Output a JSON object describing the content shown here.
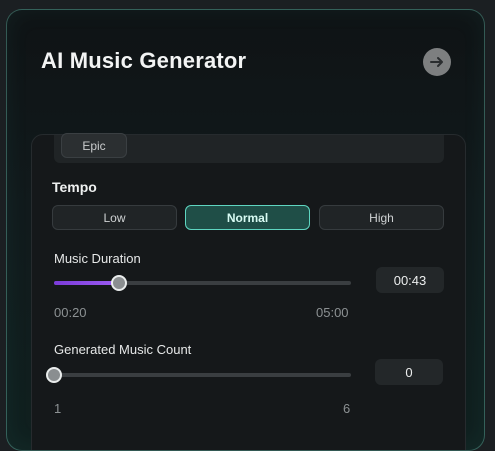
{
  "header": {
    "title": "AI Music Generator",
    "nav_icon": "arrow-right-icon"
  },
  "styles": {
    "selected_chip": "Epic"
  },
  "tempo": {
    "label": "Tempo",
    "options": [
      "Low",
      "Normal",
      "High"
    ],
    "selected": "Normal"
  },
  "duration": {
    "label": "Music Duration",
    "min_label": "00:20",
    "max_label": "05:00",
    "value": "00:43",
    "fraction": 0.22
  },
  "count": {
    "label": "Generated Music Count",
    "min_label": "1",
    "max_label": "6",
    "value": "0",
    "fraction": 0
  },
  "colors": {
    "accent": "#5fd6c1",
    "slider_fill": "#8b4be6"
  }
}
